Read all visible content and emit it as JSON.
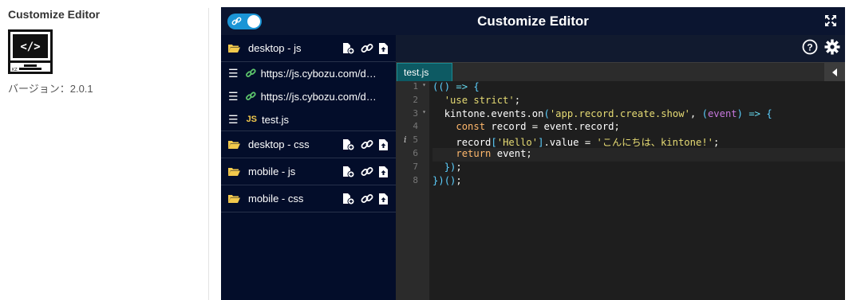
{
  "plugin": {
    "title": "Customize Editor",
    "icon": "code-monitor-icon",
    "version": "バージョン：2.0.1"
  },
  "editor": {
    "title": "Customize Editor",
    "toggle_state": "on",
    "colors": {
      "background": "#030d2a",
      "accent": "#1b95d6",
      "tab": "#0d5a63",
      "code_bg": "#1e1e1e"
    }
  },
  "sidebar": {
    "desktop_js": {
      "label": "desktop - js",
      "files": [
        {
          "icon": "link-icon",
          "label": "https://js.cybozu.com/d…"
        },
        {
          "icon": "link-icon",
          "label": "https://js.cybozu.com/d…"
        },
        {
          "icon": "js-icon",
          "badge": "JS",
          "label": "test.js"
        }
      ]
    },
    "desktop_css": {
      "label": "desktop - css"
    },
    "mobile_js": {
      "label": "mobile - js"
    },
    "mobile_css": {
      "label": "mobile - css"
    }
  },
  "tabs": [
    {
      "label": "test.js",
      "active": true
    }
  ],
  "code": {
    "line_numbers": [
      "1",
      "2",
      "3",
      "4",
      "5",
      "6",
      "7",
      "8"
    ],
    "lines": [
      "(() => {",
      "  'use strict';",
      "  kintone.events.on('app.record.create.show', (event) => {",
      "    const record = event.record;",
      "    record['Hello'].value = 'こんにちは、kintone!';",
      "    return event;",
      "  });",
      "})();"
    ],
    "active_line": 6
  }
}
